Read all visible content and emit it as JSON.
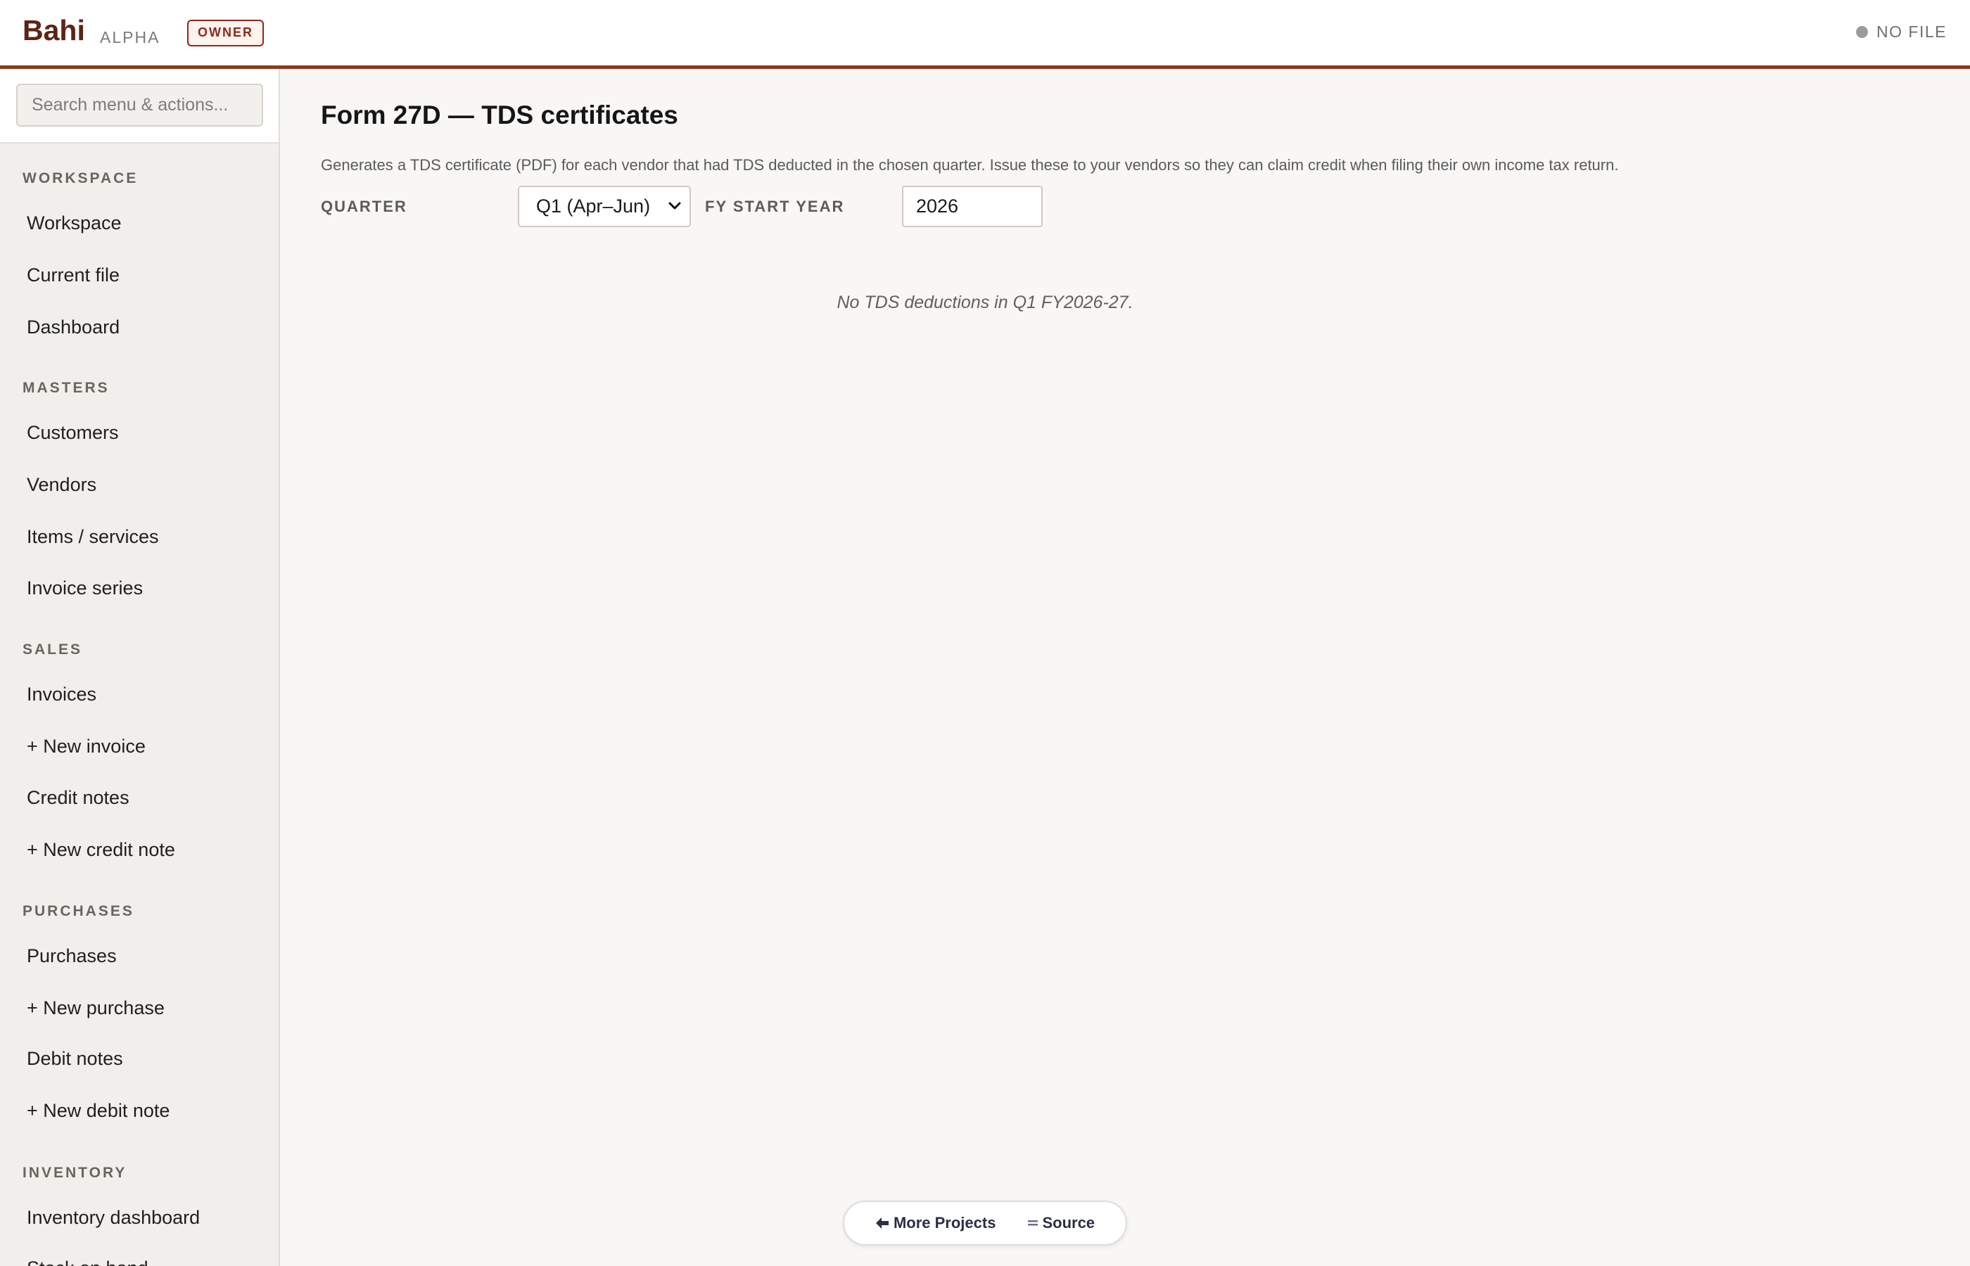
{
  "header": {
    "brand": "Bahi",
    "brand_sub": "ALPHA",
    "role_badge": "OWNER",
    "file_status": "NO FILE"
  },
  "sidebar": {
    "search_placeholder": "Search menu & actions...",
    "sections": [
      {
        "label": "WORKSPACE",
        "items": [
          "Workspace",
          "Current file",
          "Dashboard"
        ]
      },
      {
        "label": "MASTERS",
        "items": [
          "Customers",
          "Vendors",
          "Items / services",
          "Invoice series"
        ]
      },
      {
        "label": "SALES",
        "items": [
          "Invoices",
          "+ New invoice",
          "Credit notes",
          "+ New credit note"
        ]
      },
      {
        "label": "PURCHASES",
        "items": [
          "Purchases",
          "+ New purchase",
          "Debit notes",
          "+ New debit note"
        ]
      },
      {
        "label": "INVENTORY",
        "items": [
          "Inventory dashboard",
          "Stock on hand"
        ]
      }
    ]
  },
  "main": {
    "title": "Form 27D — TDS certificates",
    "description": "Generates a TDS certificate (PDF) for each vendor that had TDS deducted in the chosen quarter. Issue these to your vendors so they can claim credit when filing their own income tax return.",
    "quarter_label": "QUARTER",
    "quarter_value": "Q1 (Apr–Jun)",
    "fy_label": "FY START YEAR",
    "fy_value": "2026",
    "empty_message": "No TDS deductions in Q1 FY2026-27."
  },
  "footer": {
    "more_projects": "More Projects",
    "source": "Source"
  },
  "colors": {
    "brand": "#5c2414",
    "accent_border": "#8d3a1d",
    "badge": "#8d2a1a"
  }
}
